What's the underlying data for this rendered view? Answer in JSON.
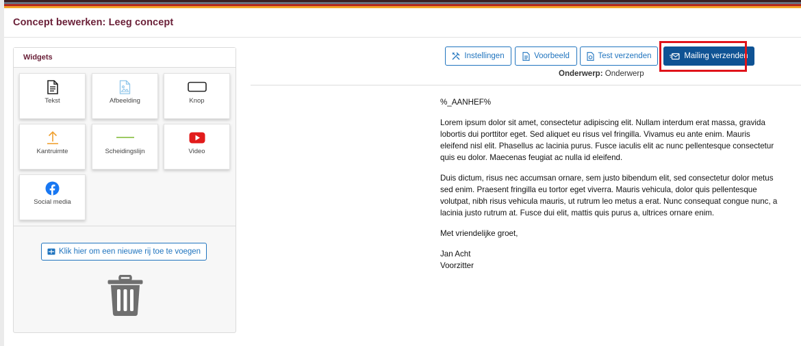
{
  "header": {
    "title": "Concept bewerken: Leeg concept"
  },
  "widgets": {
    "heading": "Widgets",
    "items": [
      {
        "label": "Tekst",
        "icon": "document-icon"
      },
      {
        "label": "Afbeelding",
        "icon": "image-icon"
      },
      {
        "label": "Knop",
        "icon": "button-icon"
      },
      {
        "label": "Kantruimte",
        "icon": "margin-icon"
      },
      {
        "label": "Scheidingslijn",
        "icon": "divider-icon"
      },
      {
        "label": "Video",
        "icon": "youtube-icon"
      },
      {
        "label": "Social media",
        "icon": "facebook-icon"
      }
    ],
    "add_row_label": "Klik hier om een nieuwe rij toe te voegen"
  },
  "toolbar": {
    "settings_label": "Instellingen",
    "preview_label": "Voorbeeld",
    "test_send_label": "Test verzenden",
    "send_label": "Mailing verzenden"
  },
  "subject": {
    "label": "Onderwerp:",
    "value": "Onderwerp"
  },
  "email": {
    "salutation": "%_AANHEF%",
    "paragraph1": "Lorem ipsum dolor sit amet, consectetur adipiscing elit. Nullam interdum erat massa, gravida lobortis dui porttitor eget. Sed aliquet eu risus vel fringilla. Vivamus eu ante enim. Mauris eleifend nisl elit. Phasellus ac lacinia purus. Fusce iaculis elit ac nunc pellentesque consectetur quis eu dolor. Maecenas feugiat ac nulla id eleifend.",
    "paragraph2": "Duis dictum, risus nec accumsan ornare, sem justo bibendum elit, sed consectetur dolor metus sed enim. Praesent fringilla eu tortor eget viverra. Mauris vehicula, dolor quis pellentesque volutpat, nibh risus vehicula mauris, ut rutrum leo metus a erat. Nunc consequat congue nunc, a lacinia justo rutrum at. Fusce dui elit, mattis quis purus a, ultrices ornare enim.",
    "closing": "Met vriendelijke groet,",
    "signature_name": "Jan Acht",
    "signature_role": "Voorzitter"
  },
  "colors": {
    "accent": "#6b2139",
    "primary": "#0f5394",
    "link": "#1e73be",
    "highlight": "#e0131a"
  }
}
